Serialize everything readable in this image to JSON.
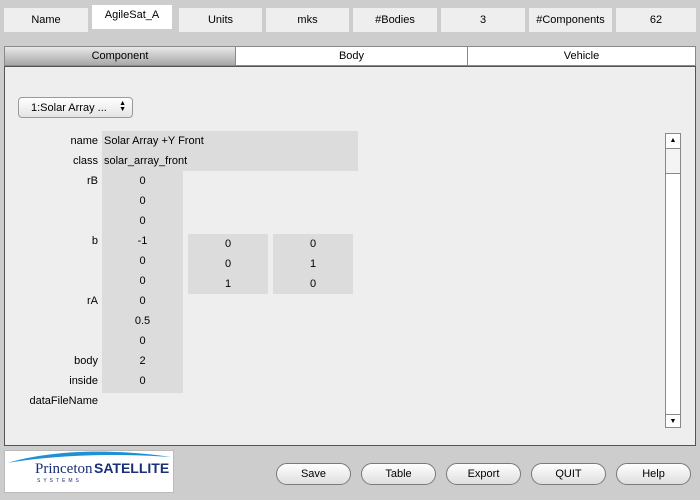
{
  "header": {
    "name_label": "Name",
    "name_value": "AgileSat_A",
    "units_label": "Units",
    "units_value": "mks",
    "bodies_label": "#Bodies",
    "bodies_value": "3",
    "components_label": "#Components",
    "components_value": "62"
  },
  "tabs": [
    {
      "label": "Component",
      "active": true
    },
    {
      "label": "Body",
      "active": false
    },
    {
      "label": "Vehicle",
      "active": false
    }
  ],
  "selector": {
    "value": "1:Solar Array ...",
    "arrows": "▲▼"
  },
  "fields": {
    "name_label": "name",
    "name_value": "Solar Array +Y Front",
    "class_label": "class",
    "class_value": "solar_array_front",
    "rB_label": "rB",
    "rB": [
      "0",
      "0",
      "0"
    ],
    "b_label": "b",
    "b": [
      [
        "-1",
        "0",
        "0"
      ],
      [
        "0",
        "0",
        "1"
      ],
      [
        "0",
        "1",
        "0"
      ]
    ],
    "rA_label": "rA",
    "rA": [
      "0",
      "0.5",
      "0"
    ],
    "body_label": "body",
    "body_value": "2",
    "inside_label": "inside",
    "inside_value": "0",
    "datafile_label": "dataFileName"
  },
  "logo": {
    "word1": "Princeton",
    "word2": "SATELLITE",
    "word3": "SYSTEMS"
  },
  "buttons": {
    "save": "Save",
    "table": "Table",
    "export": "Export",
    "quit": "QUIT",
    "help": "Help"
  },
  "colors": {
    "background": "#cdcdcd",
    "panel": "#eeeeee",
    "value_cell": "#dcdcdc",
    "logo_blue": "#1a2f7a",
    "logo_swoosh": "#1e90d6"
  }
}
